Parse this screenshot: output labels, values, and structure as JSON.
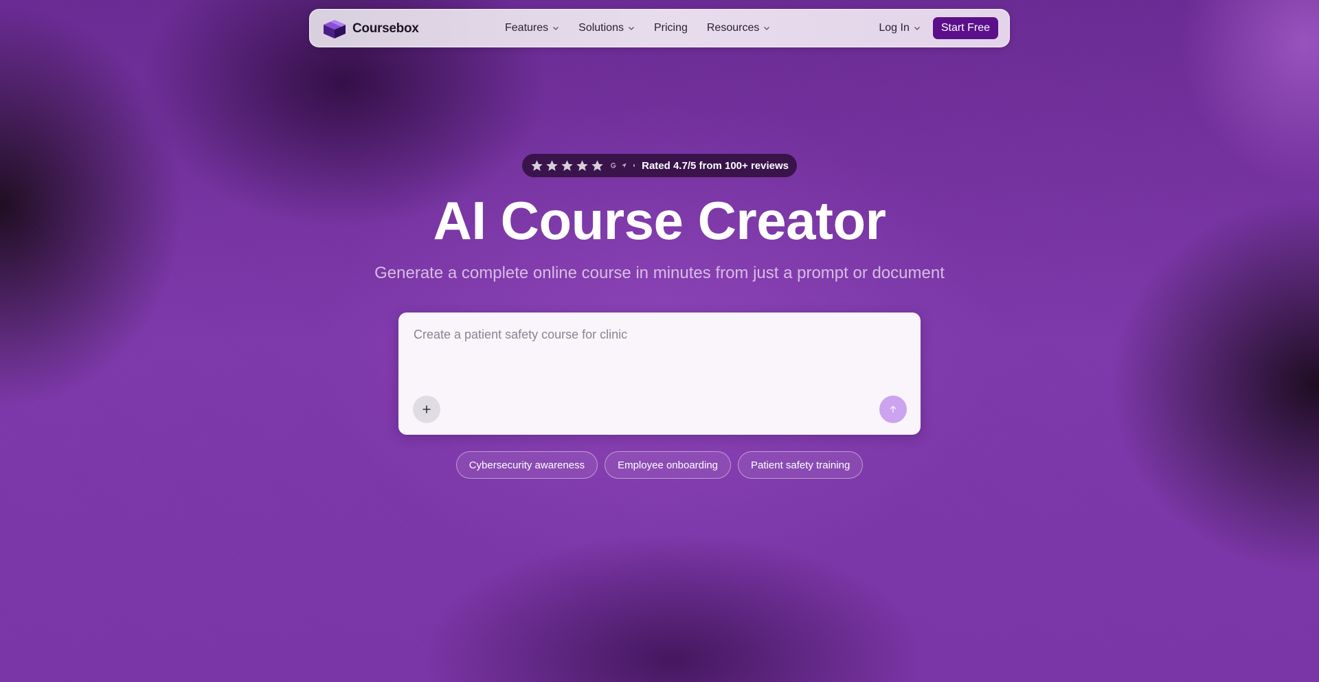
{
  "brand": {
    "name": "Coursebox",
    "accent_color": "#5b0f8a",
    "logo_icon": "cube-logo-icon"
  },
  "nav": {
    "items": [
      {
        "label": "Features",
        "has_dropdown": true
      },
      {
        "label": "Solutions",
        "has_dropdown": true
      },
      {
        "label": "Pricing",
        "has_dropdown": false
      },
      {
        "label": "Resources",
        "has_dropdown": true
      }
    ],
    "login_label": "Log In",
    "cta_label": "Start Free"
  },
  "rating": {
    "stars": 5,
    "icons": [
      "star-icon",
      "google-icon",
      "capterra-icon"
    ],
    "text": "Rated 4.7/5 from 100+ reviews"
  },
  "hero": {
    "title": "AI Course Creator",
    "subtitle": "Generate a complete online course in minutes from just a prompt or document"
  },
  "prompt": {
    "placeholder": "Create a patient safety course for clinic",
    "value": "",
    "add_icon": "plus-icon",
    "send_icon": "arrow-up-icon",
    "send_color": "#cba3ef"
  },
  "suggestions": [
    "Cybersecurity awareness",
    "Employee onboarding",
    "Patient safety training"
  ]
}
